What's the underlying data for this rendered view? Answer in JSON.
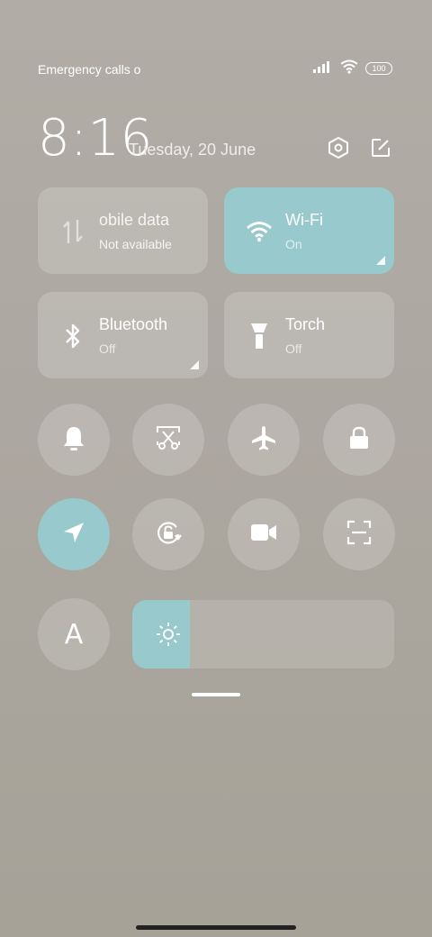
{
  "status_bar": {
    "carrier_text": "Emergency calls o",
    "battery_level": "100",
    "icons": [
      "signal-icon",
      "wifi-icon",
      "battery-icon"
    ]
  },
  "header": {
    "time": "8:16",
    "date": "Tuesday, 20 June",
    "icons": [
      "settings-icon",
      "edit-icon"
    ]
  },
  "tiles": [
    {
      "id": "mobile-data",
      "title": "obile data",
      "subtitle": "Not available",
      "icon": "mobile-data-icon",
      "active": false
    },
    {
      "id": "wifi",
      "title": "Wi-Fi",
      "subtitle": "On",
      "icon": "wifi-icon",
      "active": true
    },
    {
      "id": "bluetooth",
      "title": "Bluetooth",
      "subtitle": "Off",
      "icon": "bluetooth-icon",
      "active": false
    },
    {
      "id": "torch",
      "title": "Torch",
      "subtitle": "Off",
      "icon": "torch-icon",
      "active": false
    }
  ],
  "toggles_row1": [
    {
      "id": "sound",
      "icon": "bell-icon",
      "active": false
    },
    {
      "id": "screenshot",
      "icon": "screenshot-icon",
      "active": false
    },
    {
      "id": "airplane",
      "icon": "airplane-icon",
      "active": false
    },
    {
      "id": "lock",
      "icon": "lock-icon",
      "active": false
    }
  ],
  "toggles_row2": [
    {
      "id": "location",
      "icon": "location-icon",
      "active": true
    },
    {
      "id": "rotation-lock",
      "icon": "rotation-lock-icon",
      "active": false
    },
    {
      "id": "screen-record",
      "icon": "video-camera-icon",
      "active": false
    },
    {
      "id": "scanner",
      "icon": "scan-icon",
      "active": false
    }
  ],
  "font_toggle": {
    "label": "A",
    "icon": "font-size-icon"
  },
  "brightness": {
    "level": 0.22,
    "icon": "sun-icon"
  },
  "colors": {
    "accent": "#97c9cd",
    "tile_bg": "rgba(255,255,255,0.18)"
  }
}
